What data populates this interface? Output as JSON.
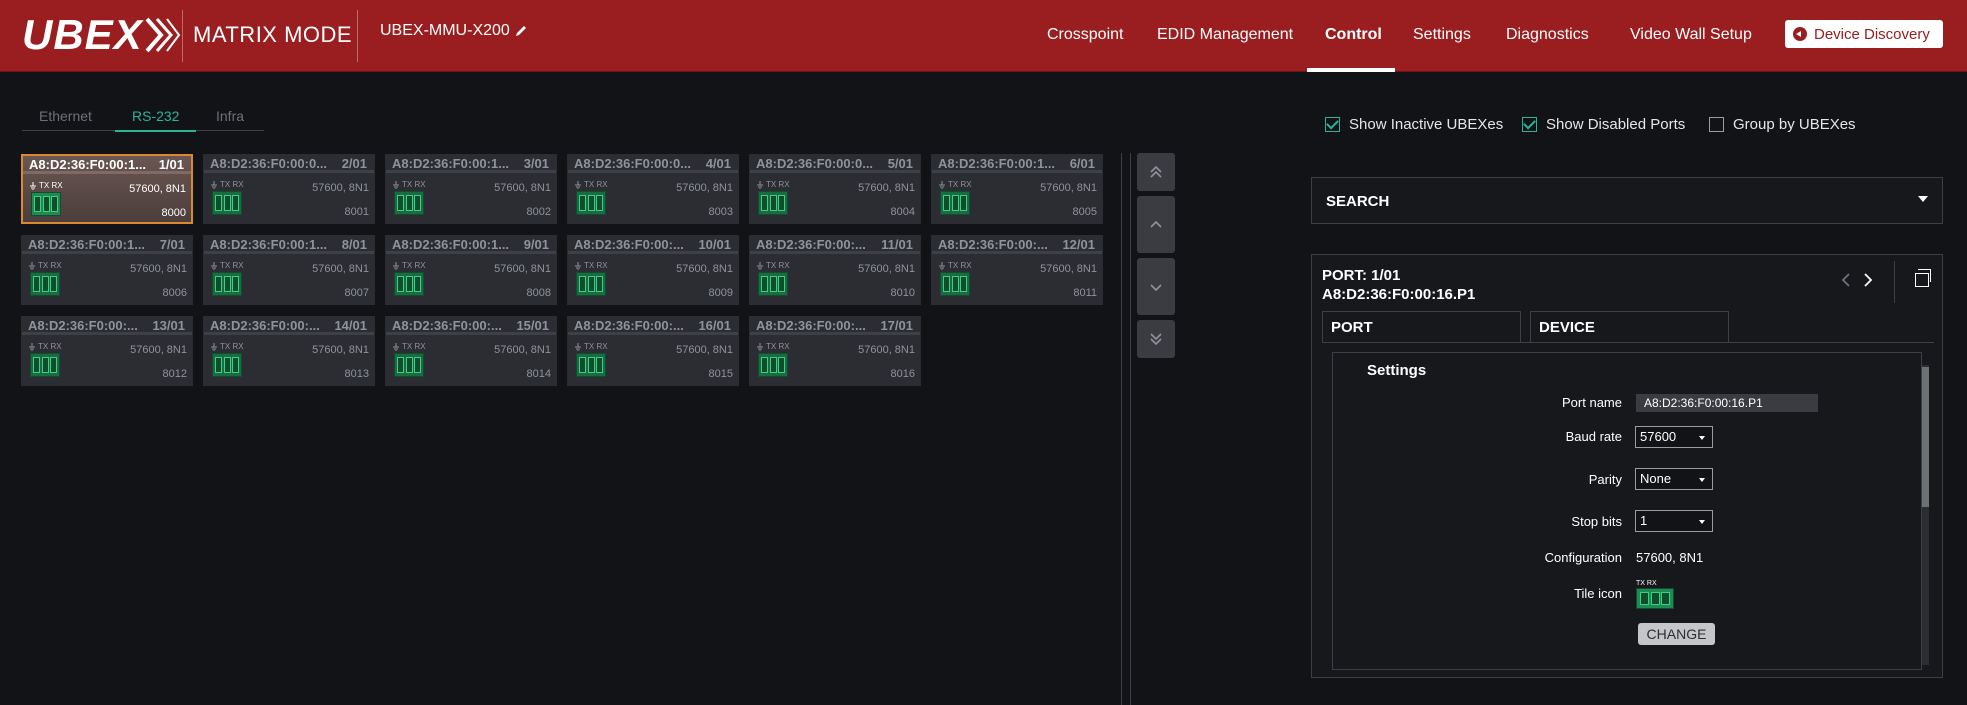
{
  "header": {
    "logo_text": "UBEX",
    "mode": "MATRIX MODE",
    "device_name": "UBEX-MMU-X200",
    "nav": [
      {
        "label": "Crosspoint",
        "active": false
      },
      {
        "label": "EDID Management",
        "active": false
      },
      {
        "label": "Control",
        "active": true
      },
      {
        "label": "Settings",
        "active": false
      },
      {
        "label": "Diagnostics",
        "active": false
      },
      {
        "label": "Video Wall Setup",
        "active": false
      }
    ],
    "discovery_label": "Device Discovery"
  },
  "subtabs": [
    {
      "label": "Ethernet",
      "active": false
    },
    {
      "label": "RS-232",
      "active": true
    },
    {
      "label": "Infra",
      "active": false
    }
  ],
  "tile_txrx": "TX RX",
  "tiles": [
    {
      "name": "A8:D2:36:F0:00:1...",
      "index": "1/01",
      "baud": "57600, 8N1",
      "port": "8000",
      "selected": true
    },
    {
      "name": "A8:D2:36:F0:00:0...",
      "index": "2/01",
      "baud": "57600, 8N1",
      "port": "8001",
      "selected": false
    },
    {
      "name": "A8:D2:36:F0:00:1...",
      "index": "3/01",
      "baud": "57600, 8N1",
      "port": "8002",
      "selected": false
    },
    {
      "name": "A8:D2:36:F0:00:0...",
      "index": "4/01",
      "baud": "57600, 8N1",
      "port": "8003",
      "selected": false
    },
    {
      "name": "A8:D2:36:F0:00:0...",
      "index": "5/01",
      "baud": "57600, 8N1",
      "port": "8004",
      "selected": false
    },
    {
      "name": "A8:D2:36:F0:00:1...",
      "index": "6/01",
      "baud": "57600, 8N1",
      "port": "8005",
      "selected": false
    },
    {
      "name": "A8:D2:36:F0:00:1...",
      "index": "7/01",
      "baud": "57600, 8N1",
      "port": "8006",
      "selected": false
    },
    {
      "name": "A8:D2:36:F0:00:1...",
      "index": "8/01",
      "baud": "57600, 8N1",
      "port": "8007",
      "selected": false
    },
    {
      "name": "A8:D2:36:F0:00:1...",
      "index": "9/01",
      "baud": "57600, 8N1",
      "port": "8008",
      "selected": false
    },
    {
      "name": "A8:D2:36:F0:00:...",
      "index": "10/01",
      "baud": "57600, 8N1",
      "port": "8009",
      "selected": false
    },
    {
      "name": "A8:D2:36:F0:00:...",
      "index": "11/01",
      "baud": "57600, 8N1",
      "port": "8010",
      "selected": false
    },
    {
      "name": "A8:D2:36:F0:00:...",
      "index": "12/01",
      "baud": "57600, 8N1",
      "port": "8011",
      "selected": false
    },
    {
      "name": "A8:D2:36:F0:00:...",
      "index": "13/01",
      "baud": "57600, 8N1",
      "port": "8012",
      "selected": false
    },
    {
      "name": "A8:D2:36:F0:00:...",
      "index": "14/01",
      "baud": "57600, 8N1",
      "port": "8013",
      "selected": false
    },
    {
      "name": "A8:D2:36:F0:00:...",
      "index": "15/01",
      "baud": "57600, 8N1",
      "port": "8014",
      "selected": false
    },
    {
      "name": "A8:D2:36:F0:00:...",
      "index": "16/01",
      "baud": "57600, 8N1",
      "port": "8015",
      "selected": false
    },
    {
      "name": "A8:D2:36:F0:00:...",
      "index": "17/01",
      "baud": "57600, 8N1",
      "port": "8016",
      "selected": false
    }
  ],
  "filters": [
    {
      "label": "Show Inactive UBEXes",
      "checked": true
    },
    {
      "label": "Show Disabled Ports",
      "checked": true
    },
    {
      "label": "Group by UBEXes",
      "checked": false
    }
  ],
  "search_label": "SEARCH",
  "detail": {
    "port_line": "PORT: 1/01",
    "port_id": "A8:D2:36:F0:00:16.P1",
    "tabs": [
      {
        "label": "PORT",
        "active": true
      },
      {
        "label": "DEVICE",
        "active": false
      }
    ],
    "settings_title": "Settings",
    "labels": {
      "port_name": "Port name",
      "baud_rate": "Baud rate",
      "parity": "Parity",
      "stop_bits": "Stop bits",
      "configuration": "Configuration",
      "tile_icon": "Tile icon"
    },
    "values": {
      "port_name": "A8:D2:36:F0:00:16.P1",
      "baud_rate": "57600",
      "parity": "None",
      "stop_bits": "1",
      "configuration": "57600, 8N1",
      "tile_icon_txrx": "TX RX"
    },
    "change_label": "CHANGE"
  },
  "colors": {
    "header_bg": "#9a1d20",
    "accent": "#2bb39a",
    "selected_border": "#d9892e",
    "connector_green": "#1f8a52"
  }
}
